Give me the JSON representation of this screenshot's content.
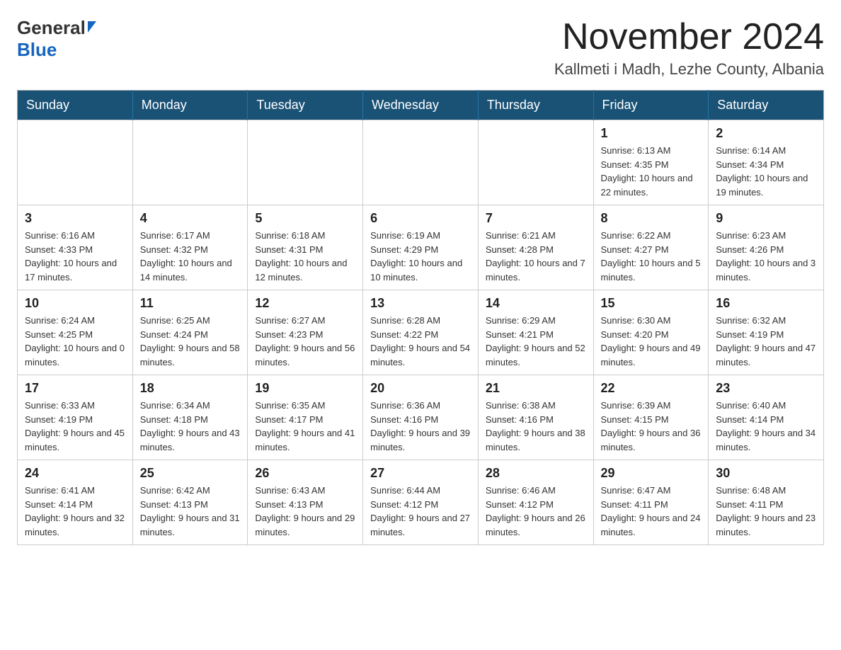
{
  "logo": {
    "general": "General",
    "blue": "Blue"
  },
  "title": "November 2024",
  "location": "Kallmeti i Madh, Lezhe County, Albania",
  "days_header": [
    "Sunday",
    "Monday",
    "Tuesday",
    "Wednesday",
    "Thursday",
    "Friday",
    "Saturday"
  ],
  "weeks": [
    [
      {
        "day": "",
        "info": ""
      },
      {
        "day": "",
        "info": ""
      },
      {
        "day": "",
        "info": ""
      },
      {
        "day": "",
        "info": ""
      },
      {
        "day": "",
        "info": ""
      },
      {
        "day": "1",
        "info": "Sunrise: 6:13 AM\nSunset: 4:35 PM\nDaylight: 10 hours and 22 minutes."
      },
      {
        "day": "2",
        "info": "Sunrise: 6:14 AM\nSunset: 4:34 PM\nDaylight: 10 hours and 19 minutes."
      }
    ],
    [
      {
        "day": "3",
        "info": "Sunrise: 6:16 AM\nSunset: 4:33 PM\nDaylight: 10 hours and 17 minutes."
      },
      {
        "day": "4",
        "info": "Sunrise: 6:17 AM\nSunset: 4:32 PM\nDaylight: 10 hours and 14 minutes."
      },
      {
        "day": "5",
        "info": "Sunrise: 6:18 AM\nSunset: 4:31 PM\nDaylight: 10 hours and 12 minutes."
      },
      {
        "day": "6",
        "info": "Sunrise: 6:19 AM\nSunset: 4:29 PM\nDaylight: 10 hours and 10 minutes."
      },
      {
        "day": "7",
        "info": "Sunrise: 6:21 AM\nSunset: 4:28 PM\nDaylight: 10 hours and 7 minutes."
      },
      {
        "day": "8",
        "info": "Sunrise: 6:22 AM\nSunset: 4:27 PM\nDaylight: 10 hours and 5 minutes."
      },
      {
        "day": "9",
        "info": "Sunrise: 6:23 AM\nSunset: 4:26 PM\nDaylight: 10 hours and 3 minutes."
      }
    ],
    [
      {
        "day": "10",
        "info": "Sunrise: 6:24 AM\nSunset: 4:25 PM\nDaylight: 10 hours and 0 minutes."
      },
      {
        "day": "11",
        "info": "Sunrise: 6:25 AM\nSunset: 4:24 PM\nDaylight: 9 hours and 58 minutes."
      },
      {
        "day": "12",
        "info": "Sunrise: 6:27 AM\nSunset: 4:23 PM\nDaylight: 9 hours and 56 minutes."
      },
      {
        "day": "13",
        "info": "Sunrise: 6:28 AM\nSunset: 4:22 PM\nDaylight: 9 hours and 54 minutes."
      },
      {
        "day": "14",
        "info": "Sunrise: 6:29 AM\nSunset: 4:21 PM\nDaylight: 9 hours and 52 minutes."
      },
      {
        "day": "15",
        "info": "Sunrise: 6:30 AM\nSunset: 4:20 PM\nDaylight: 9 hours and 49 minutes."
      },
      {
        "day": "16",
        "info": "Sunrise: 6:32 AM\nSunset: 4:19 PM\nDaylight: 9 hours and 47 minutes."
      }
    ],
    [
      {
        "day": "17",
        "info": "Sunrise: 6:33 AM\nSunset: 4:19 PM\nDaylight: 9 hours and 45 minutes."
      },
      {
        "day": "18",
        "info": "Sunrise: 6:34 AM\nSunset: 4:18 PM\nDaylight: 9 hours and 43 minutes."
      },
      {
        "day": "19",
        "info": "Sunrise: 6:35 AM\nSunset: 4:17 PM\nDaylight: 9 hours and 41 minutes."
      },
      {
        "day": "20",
        "info": "Sunrise: 6:36 AM\nSunset: 4:16 PM\nDaylight: 9 hours and 39 minutes."
      },
      {
        "day": "21",
        "info": "Sunrise: 6:38 AM\nSunset: 4:16 PM\nDaylight: 9 hours and 38 minutes."
      },
      {
        "day": "22",
        "info": "Sunrise: 6:39 AM\nSunset: 4:15 PM\nDaylight: 9 hours and 36 minutes."
      },
      {
        "day": "23",
        "info": "Sunrise: 6:40 AM\nSunset: 4:14 PM\nDaylight: 9 hours and 34 minutes."
      }
    ],
    [
      {
        "day": "24",
        "info": "Sunrise: 6:41 AM\nSunset: 4:14 PM\nDaylight: 9 hours and 32 minutes."
      },
      {
        "day": "25",
        "info": "Sunrise: 6:42 AM\nSunset: 4:13 PM\nDaylight: 9 hours and 31 minutes."
      },
      {
        "day": "26",
        "info": "Sunrise: 6:43 AM\nSunset: 4:13 PM\nDaylight: 9 hours and 29 minutes."
      },
      {
        "day": "27",
        "info": "Sunrise: 6:44 AM\nSunset: 4:12 PM\nDaylight: 9 hours and 27 minutes."
      },
      {
        "day": "28",
        "info": "Sunrise: 6:46 AM\nSunset: 4:12 PM\nDaylight: 9 hours and 26 minutes."
      },
      {
        "day": "29",
        "info": "Sunrise: 6:47 AM\nSunset: 4:11 PM\nDaylight: 9 hours and 24 minutes."
      },
      {
        "day": "30",
        "info": "Sunrise: 6:48 AM\nSunset: 4:11 PM\nDaylight: 9 hours and 23 minutes."
      }
    ]
  ]
}
